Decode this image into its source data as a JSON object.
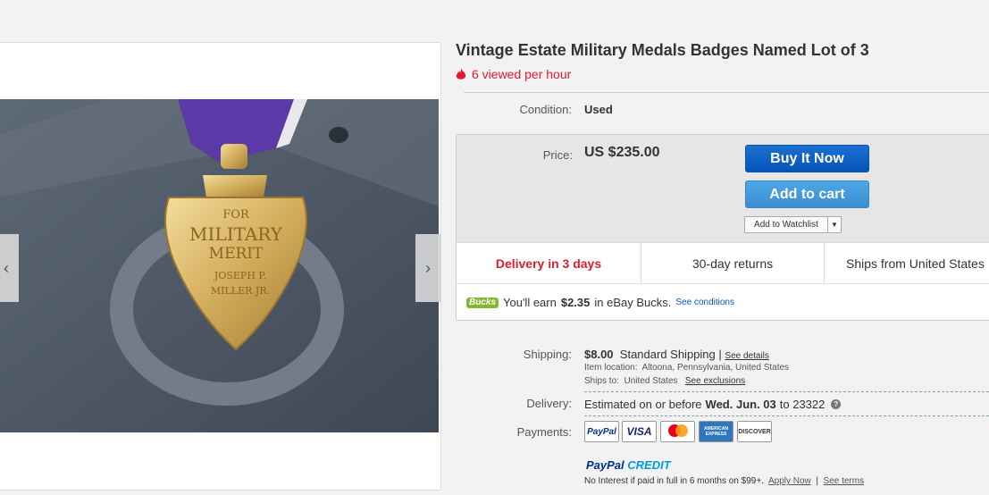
{
  "listing": {
    "title": "Vintage Estate Military Medals Badges Named Lot of 3",
    "viewed": "6 viewed per hour",
    "condition_label": "Condition:",
    "condition_value": "Used",
    "price_label": "Price:",
    "price_value": "US $235.00"
  },
  "image": {
    "prev_arrow": "‹",
    "next_arrow": "›",
    "medal_text": [
      "FOR",
      "MILITARY",
      "MERIT",
      "JOSEPH P.",
      "MILLER JR."
    ]
  },
  "buttons": {
    "buy_now": "Buy It Now",
    "add_to_cart": "Add to cart",
    "watchlist": "Add to Watchlist",
    "watchlist_caret": "▼"
  },
  "features": {
    "delivery": "Delivery in 3 days",
    "returns": "30-day returns",
    "ships_from": "Ships from United States"
  },
  "bucks": {
    "badge": "Bucks",
    "text_pre": "You'll earn",
    "amount": "$2.35",
    "text_post": "in eBay Bucks.",
    "link": "See conditions"
  },
  "shipping": {
    "label": "Shipping:",
    "cost": "$8.00",
    "method": "Standard Shipping",
    "divider": "|",
    "details_link": "See details",
    "location_label": "Item location:",
    "location_value": "Altoona, Pennsylvania, United States",
    "ships_to_label": "Ships to:",
    "ships_to_value": "United States",
    "exclusions_link": "See exclusions"
  },
  "delivery": {
    "label": "Delivery:",
    "text_pre": "Estimated on or before",
    "date": "Wed. Jun. 03",
    "text_post": "to 23322",
    "help": "?"
  },
  "payments": {
    "label": "Payments:",
    "methods": [
      "PayPal",
      "VISA",
      "MasterCard",
      "AMERICAN EXPRESS",
      "DISCOVER"
    ],
    "paypal_credit_a": "PayPal",
    "paypal_credit_b": "CREDIT",
    "credit_text": "No Interest if paid in full in 6 months on $99+.",
    "apply_link": "Apply Now",
    "divider": "|",
    "terms_link": "See terms"
  },
  "colors": {
    "accent_red": "#dd1e31",
    "button_blue": "#0654ba",
    "link_blue": "#0654ba",
    "paypal_navy": "#003087",
    "paypal_blue": "#009cde",
    "medal_ribbon": "#5b3aa8"
  },
  "icons": {
    "viewed": "flame-icon",
    "help": "question-circle-icon"
  }
}
